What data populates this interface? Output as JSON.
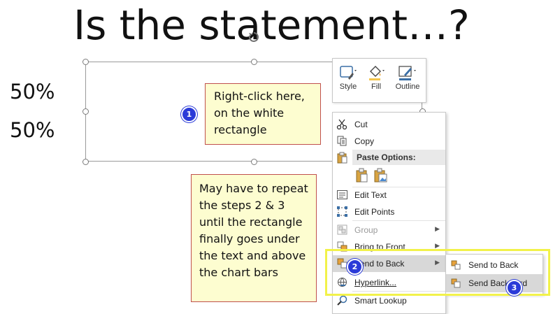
{
  "slide": {
    "title": "Is the statement…?",
    "left_values": [
      "50%",
      "50%"
    ]
  },
  "notes": {
    "note1": "Right-click here, on the white rectangle",
    "note2": "May have to repeat the steps 2 & 3 until the rectangle finally goes under the text and above the chart bars"
  },
  "badges": [
    "1",
    "2",
    "3"
  ],
  "mini_toolbar": {
    "style_label": "Style",
    "fill_label": "Fill",
    "outline_label": "Outline"
  },
  "context_menu": {
    "cut": "Cut",
    "copy": "Copy",
    "paste_options": "Paste Options:",
    "edit_text": "Edit Text",
    "edit_points": "Edit Points",
    "group": "Group",
    "bring_to_front": "Bring to Front",
    "send_to_back": "Send to Back",
    "hyperlink": "Hyperlink...",
    "smart_lookup": "Smart Lookup"
  },
  "submenu": {
    "send_to_back": "Send to Back",
    "send_backward": "Send Backward"
  },
  "colors": {
    "note_fill": "#fdfdd0",
    "note_border": "#c0504d",
    "badge": "#2b3bd8",
    "highlight_frame": "#f2f24a"
  }
}
